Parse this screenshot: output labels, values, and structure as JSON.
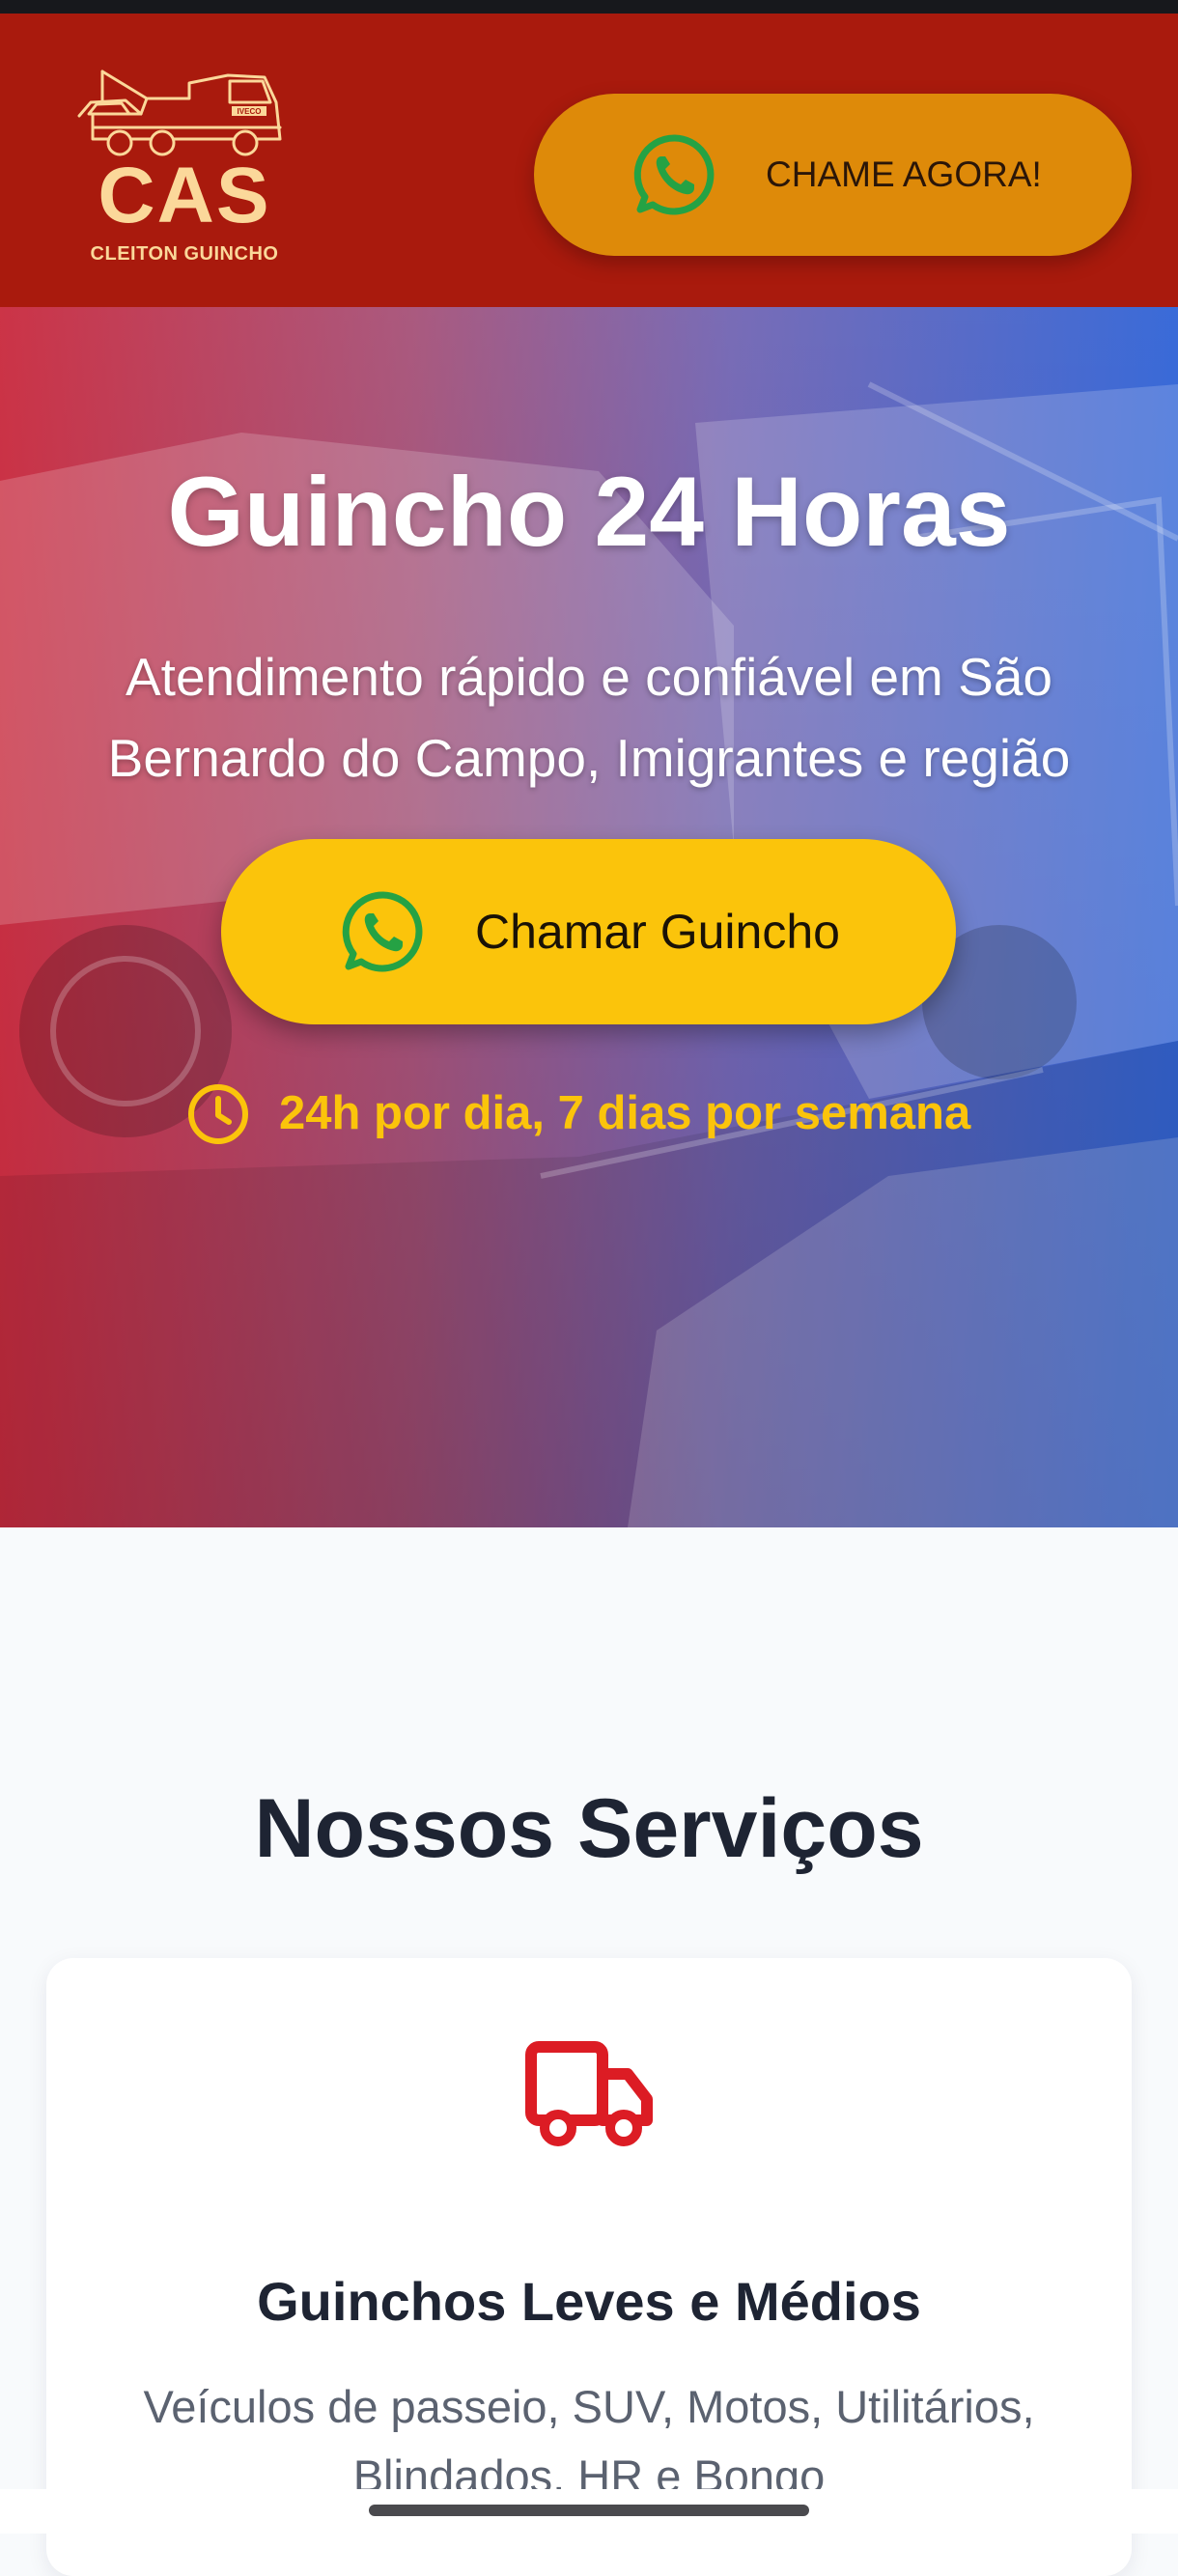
{
  "header": {
    "logo": {
      "brand": "CAS",
      "tagline": "CLEITON GUINCHO",
      "truck_badge": "IVECO"
    },
    "cta_label": "CHAME AGORA!",
    "cta_icon": "whatsapp-icon"
  },
  "hero": {
    "title": "Guincho 24 Horas",
    "subtitle": "Atendimento rápido e confiável em São Bernardo do Campo, Imigrantes e região",
    "cta_label": "Chamar Guincho",
    "cta_icon": "whatsapp-icon",
    "hours_icon": "clock-icon",
    "hours_text": "24h por dia, 7 dias por semana"
  },
  "services": {
    "title": "Nossos Serviços",
    "items": [
      {
        "icon": "truck-icon",
        "title": "Guinchos Leves e Médios",
        "description": "Veículos de passeio, SUV, Motos, Utilitários, Blindados, HR e Bongo"
      }
    ]
  },
  "colors": {
    "header_bg": "#a91a0d",
    "header_cta_bg": "#de8a09",
    "hero_cta_bg": "#fbc40b",
    "accent_yellow": "#fbc40b",
    "whatsapp_green": "#25a244",
    "icon_red": "#dc1c24",
    "heading_dark": "#1e2433",
    "logo_cream": "#fbd89a"
  }
}
